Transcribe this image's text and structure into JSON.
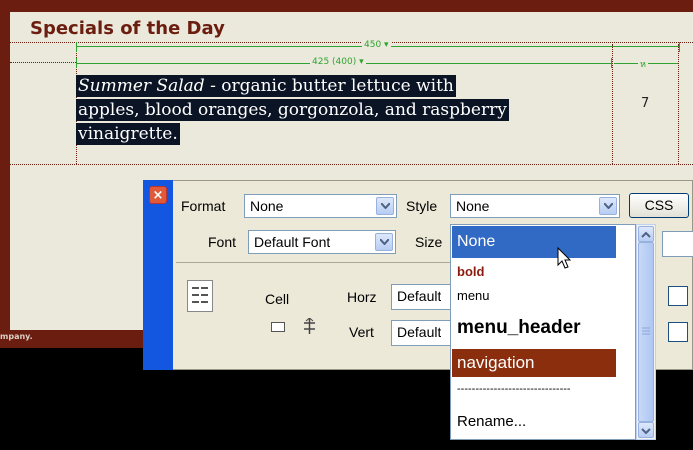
{
  "page": {
    "heading": "Specials of the Day",
    "width_guide_outer": "450 ▾",
    "width_guide_inner": "425 (400) ▾",
    "width_guide_small": "ห",
    "paragraph": {
      "line1_italic": "Summer Salad",
      "line1_rest": " - organic butter lettuce with",
      "line2": "apples, blood oranges, gorgonzola, and raspberry",
      "line3": "vinaigrette."
    },
    "side_cell_value": "7",
    "footer_fragment": "mpany."
  },
  "inspector": {
    "format_label": "Format",
    "format_value": "None",
    "style_label": "Style",
    "style_value": "None",
    "css_button": "CSS",
    "font_label": "Font",
    "font_value": "Default Font",
    "size_label": "Size",
    "cell_label": "Cell",
    "horz_label": "Horz",
    "horz_value": "Default",
    "vert_label": "Vert",
    "vert_value": "Default"
  },
  "style_dropdown": {
    "options": [
      {
        "label": "None",
        "state": "highlighted"
      },
      {
        "label": "bold",
        "state": "normal"
      },
      {
        "label": "menu",
        "state": "normal"
      },
      {
        "label": "menu_header",
        "state": "normal"
      },
      {
        "label": "navigation",
        "state": "normal"
      },
      {
        "label": "-------------------------------",
        "state": "separator"
      },
      {
        "label": "Rename...",
        "state": "normal"
      }
    ]
  },
  "colors": {
    "maroon": "#6b1e10",
    "content_bg": "#ebe9dc",
    "guide_green": "#2fa32f",
    "selection_bg": "#0b1424",
    "highlight_blue": "#316ac5",
    "navigation_bg": "#8b2e0e"
  }
}
